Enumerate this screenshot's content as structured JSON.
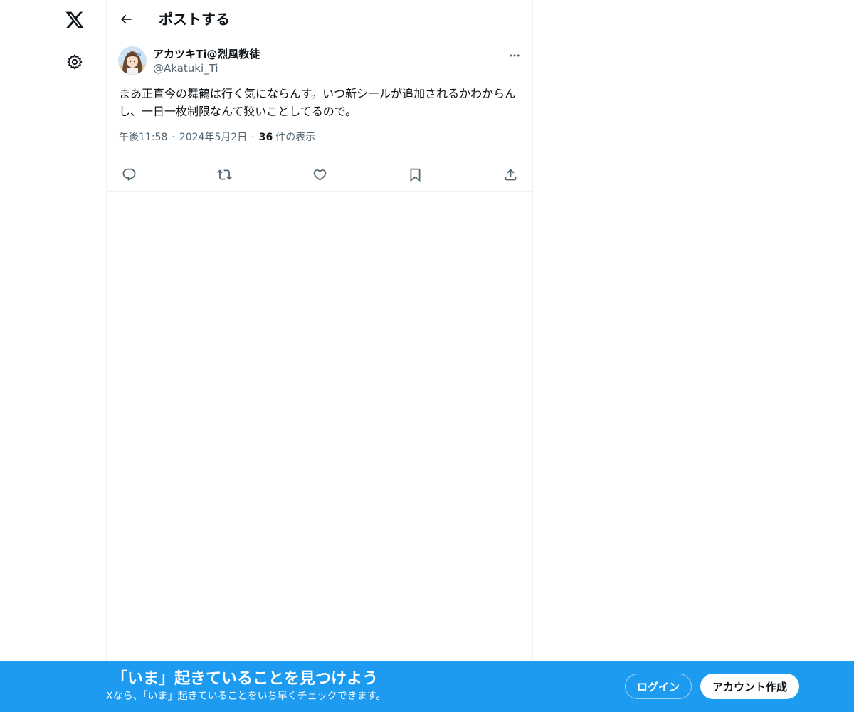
{
  "nav": {
    "logo_icon": "x-logo-icon",
    "settings_icon": "gear-icon"
  },
  "header": {
    "title": "ポストする",
    "back_icon": "arrow-left-icon"
  },
  "post": {
    "display_name": "アカツキTi@烈風教徒",
    "handle": "@Akatuki_Ti",
    "text": "まあ正直今の舞鶴は行く気にならんす。いつ新シールが追加されるかわからんし、一日一枚制限なんて狡いことしてるので。",
    "time": "午後11:58",
    "date": "2024年5月2日",
    "separator": "·",
    "views_count": "36",
    "views_label": "件の表示",
    "more_icon": "more-dots-icon"
  },
  "actions": [
    {
      "name": "reply",
      "icon": "reply-icon"
    },
    {
      "name": "repost",
      "icon": "repost-icon"
    },
    {
      "name": "like",
      "icon": "heart-icon"
    },
    {
      "name": "bookmark",
      "icon": "bookmark-icon"
    },
    {
      "name": "share",
      "icon": "share-icon"
    }
  ],
  "banner": {
    "title": "「いま」起きていることを見つけよう",
    "subtitle": "Xなら、「いま」起きていることをいち早くチェックできます。",
    "login_label": "ログイン",
    "signup_label": "アカウント作成"
  },
  "colors": {
    "accent": "#1d9bf0",
    "text_primary": "#0f1419",
    "text_secondary": "#536471",
    "border": "#eff3f4"
  }
}
